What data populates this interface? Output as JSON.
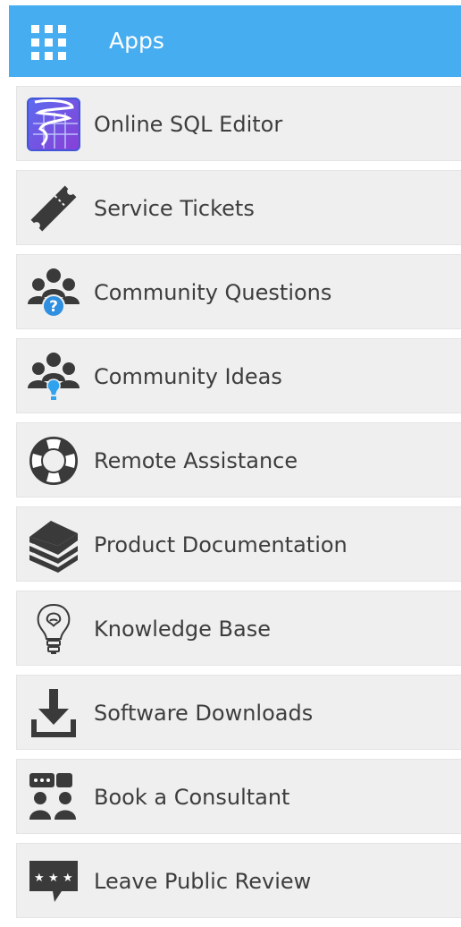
{
  "header": {
    "title": "Apps",
    "icon": "apps-grid-icon",
    "color": "#46adf0"
  },
  "items": [
    {
      "label": "Online SQL Editor",
      "icon": "sql-editor-icon"
    },
    {
      "label": "Service Tickets",
      "icon": "ticket-icon"
    },
    {
      "label": "Community Questions",
      "icon": "community-questions-icon"
    },
    {
      "label": "Community Ideas",
      "icon": "community-ideas-icon"
    },
    {
      "label": "Remote Assistance",
      "icon": "lifebuoy-icon"
    },
    {
      "label": "Product Documentation",
      "icon": "books-icon"
    },
    {
      "label": "Knowledge Base",
      "icon": "lightbulb-icon"
    },
    {
      "label": "Software Downloads",
      "icon": "download-icon"
    },
    {
      "label": "Book a Consultant",
      "icon": "consultant-icon"
    },
    {
      "label": "Leave Public Review",
      "icon": "review-icon"
    }
  ]
}
